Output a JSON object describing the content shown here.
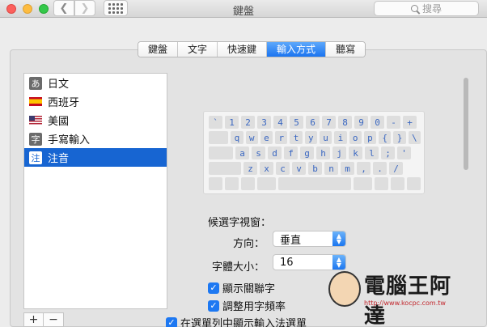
{
  "window": {
    "title": "鍵盤"
  },
  "search": {
    "placeholder": "搜尋"
  },
  "tabs": [
    "鍵盤",
    "文字",
    "快速鍵",
    "輸入方式",
    "聽寫"
  ],
  "active_tab": "輸入方式",
  "sources": [
    {
      "label": "日文",
      "icon": "a-char",
      "glyph": "あ"
    },
    {
      "label": "西班牙",
      "icon": "spain-flag-icon"
    },
    {
      "label": "美國",
      "icon": "us-flag-icon"
    },
    {
      "label": "手寫輸入",
      "icon": "char",
      "glyph": "字"
    },
    {
      "label": "注音",
      "icon": "char",
      "glyph": "注",
      "selected": true
    }
  ],
  "list_buttons": {
    "add": "+",
    "remove": "−"
  },
  "keyboard": {
    "rows": [
      [
        "`",
        "1",
        "2",
        "3",
        "4",
        "5",
        "6",
        "7",
        "8",
        "9",
        "0",
        "-",
        "+"
      ],
      [
        "",
        "q",
        "w",
        "e",
        "r",
        "t",
        "y",
        "u",
        "i",
        "o",
        "p",
        "{",
        "}",
        "\\"
      ],
      [
        "",
        "a",
        "s",
        "d",
        "f",
        "g",
        "h",
        "j",
        "k",
        "l",
        ";",
        "'"
      ],
      [
        "",
        "z",
        "x",
        "c",
        "v",
        "b",
        "n",
        "m",
        ",",
        ".",
        "/"
      ],
      [
        "",
        "",
        "",
        "",
        "",
        "",
        "",
        "",
        "",
        "",
        "",
        "",
        ""
      ]
    ]
  },
  "candidate": {
    "section_title": "候選字視窗：",
    "direction_label": "方向：",
    "direction_value": "垂直",
    "font_size_label": "字體大小：",
    "font_size_value": "16"
  },
  "checkboxes": {
    "show_related": "顯示關聯字",
    "adjust_frequency": "調整用字頻率",
    "show_in_menu": "在選單列中顯示輸入法選單"
  },
  "watermark": {
    "brand": "電腦王阿達",
    "url": "http://www.kocpc.com.tw"
  }
}
